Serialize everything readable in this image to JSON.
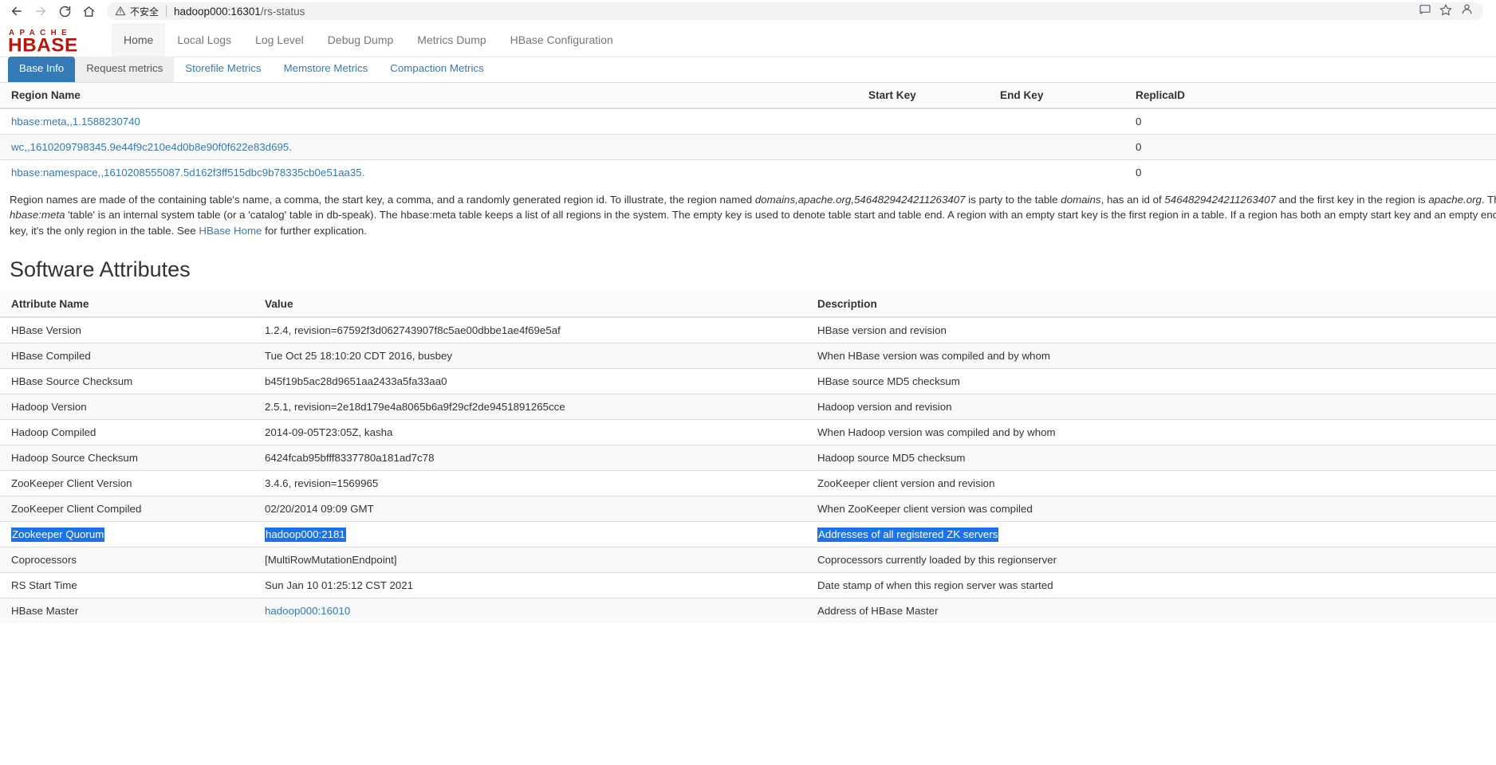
{
  "browser": {
    "back_icon": "arrow-left-icon",
    "forward_icon": "arrow-right-icon",
    "reload_icon": "reload-icon",
    "home_icon": "home-icon",
    "security_label": "不安全",
    "url_host": "hadoop000:16301",
    "url_path": "/rs-status",
    "cast_icon": "cast-icon",
    "bookmark_icon": "star-icon",
    "profile_icon": "profile-avatar-icon"
  },
  "navbar": {
    "brand_top": "A P A C H E",
    "brand_main": "HBASE",
    "items": [
      {
        "label": "Home",
        "active": true
      },
      {
        "label": "Local Logs",
        "active": false
      },
      {
        "label": "Log Level",
        "active": false
      },
      {
        "label": "Debug Dump",
        "active": false
      },
      {
        "label": "Metrics Dump",
        "active": false
      },
      {
        "label": "HBase Configuration",
        "active": false
      }
    ]
  },
  "tabs": [
    {
      "label": "Base Info",
      "state": "active"
    },
    {
      "label": "Request metrics",
      "state": "hovered"
    },
    {
      "label": "Storefile Metrics",
      "state": "link"
    },
    {
      "label": "Memstore Metrics",
      "state": "link"
    },
    {
      "label": "Compaction Metrics",
      "state": "link"
    }
  ],
  "region_table": {
    "headers": {
      "region_name": "Region Name",
      "start_key": "Start Key",
      "end_key": "End Key",
      "replica_id": "ReplicaID"
    },
    "rows": [
      {
        "region_name": "hbase:meta,,1.1588230740",
        "start_key": "",
        "end_key": "",
        "replica_id": "0"
      },
      {
        "region_name": "wc,,1610209798345.9e44f9c210e4d0b8e90f0f622e83d695.",
        "start_key": "",
        "end_key": "",
        "replica_id": "0"
      },
      {
        "region_name": "hbase:namespace,,1610208555087.5d162f3ff515dbc9b78335cb0e51aa35.",
        "start_key": "",
        "end_key": "",
        "replica_id": "0"
      }
    ]
  },
  "explanation": {
    "p1": "Region names are made of the containing table's name, a comma, the start key, a comma, and a randomly generated region id. To illustrate, the region named ",
    "em1": "domains,apache.org,5464829424211263407",
    "p2": " is party to the table ",
    "em2": "domains",
    "p3": ", has an id of ",
    "em3": "5464829424211263407",
    "p4": " and the first key in the region is ",
    "em4": "apache.org",
    "p5": ". The ",
    "em5": "hbase:meta",
    "p6": " 'table' is an internal system table (or a 'catalog' table in db-speak). The hbase:meta table keeps a list of all regions in the system. The empty key is used to denote table start and table end. A region with an empty start key is the first region in a table. If a region has both an empty start key and an empty end key, it's the only region in the table. See ",
    "link_label": "HBase Home",
    "p7": " for further explication."
  },
  "software_attributes": {
    "title": "Software Attributes",
    "headers": {
      "attribute_name": "Attribute Name",
      "value": "Value",
      "description": "Description"
    },
    "rows": [
      {
        "name": "HBase Version",
        "value": "1.2.4, revision=67592f3d062743907f8c5ae00dbbe1ae4f69e5af",
        "description": "HBase version and revision"
      },
      {
        "name": "HBase Compiled",
        "value": "Tue Oct 25 18:10:20 CDT 2016, busbey",
        "description": "When HBase version was compiled and by whom"
      },
      {
        "name": "HBase Source Checksum",
        "value": "b45f19b5ac28d9651aa2433a5fa33aa0",
        "description": "HBase source MD5 checksum"
      },
      {
        "name": "Hadoop Version",
        "value": "2.5.1, revision=2e18d179e4a8065b6a9f29cf2de9451891265cce",
        "description": "Hadoop version and revision"
      },
      {
        "name": "Hadoop Compiled",
        "value": "2014-09-05T23:05Z, kasha",
        "description": "When Hadoop version was compiled and by whom"
      },
      {
        "name": "Hadoop Source Checksum",
        "value": "6424fcab95bfff8337780a181ad7c78",
        "description": "Hadoop source MD5 checksum"
      },
      {
        "name": "ZooKeeper Client Version",
        "value": "3.4.6, revision=1569965",
        "description": "ZooKeeper client version and revision"
      },
      {
        "name": "ZooKeeper Client Compiled",
        "value": "02/20/2014 09:09 GMT",
        "description": "When ZooKeeper client version was compiled"
      },
      {
        "name": "Zookeeper Quorum",
        "value": "hadoop000:2181",
        "description": "Addresses of all registered ZK servers",
        "selected": true
      },
      {
        "name": "Coprocessors",
        "value": "[MultiRowMutationEndpoint]",
        "description": "Coprocessors currently loaded by this regionserver"
      },
      {
        "name": "RS Start Time",
        "value": "Sun Jan 10 01:25:12 CST 2021",
        "description": "Date stamp of when this region server was started"
      },
      {
        "name": "HBase Master",
        "value": "hadoop000:16010",
        "description": "Address of HBase Master",
        "value_is_link": true
      }
    ]
  },
  "colors": {
    "link": "#337ab7",
    "active_tab_bg": "#337ab7",
    "selection_blue": "#1a73e8",
    "brand_red": "#ba160c"
  }
}
